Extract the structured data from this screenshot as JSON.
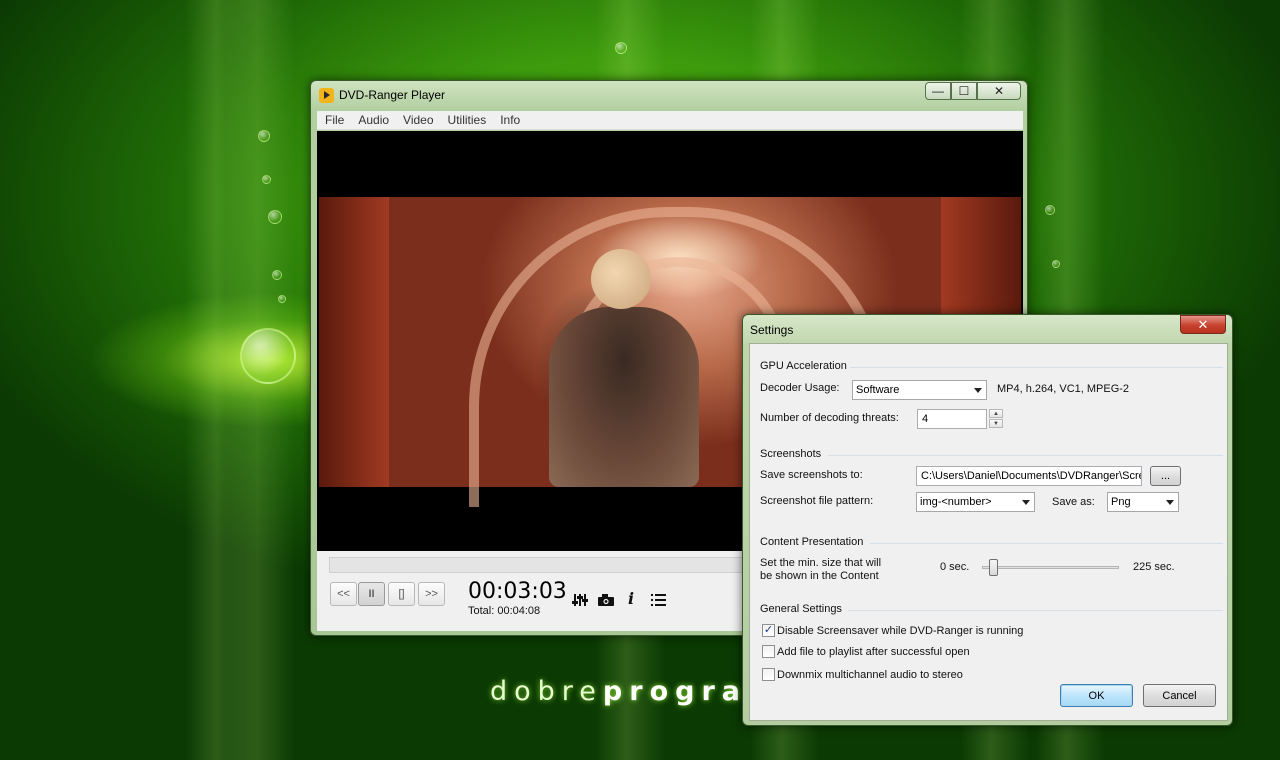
{
  "wallpaper": {
    "brand_light": "dobre",
    "brand_bold": "progra"
  },
  "player": {
    "title": "DVD-Ranger Player",
    "menu": [
      "File",
      "Audio",
      "Video",
      "Utilities",
      "Info"
    ],
    "controls": {
      "prev_label": "<<",
      "pause_label": "II",
      "stop_label": "[]",
      "next_label": ">>",
      "current_time": "00:03:03",
      "total_time": "Total: 00:04:08",
      "equalizer_icon": "equalizer-icon",
      "screenshot_icon": "camera-icon",
      "info_icon": "info-icon",
      "playlist_icon": "playlist-icon"
    },
    "caption": {
      "minimize": "—",
      "maximize": "☐",
      "close": "✕"
    }
  },
  "settings": {
    "title": "Settings",
    "close": "✕",
    "gpu": {
      "heading": "GPU Acceleration",
      "decoder_label": "Decoder Usage:",
      "decoder_value": "Software",
      "formats": "MP4, h.264, VC1, MPEG-2",
      "threads_label": "Number of decoding threats:",
      "threads_value": "4"
    },
    "screenshots": {
      "heading": "Screenshots",
      "save_label": "Save screenshots to:",
      "save_path": "C:\\Users\\Daniel\\Documents\\DVDRanger\\Scree",
      "browse_label": "...",
      "pattern_label": "Screenshot file pattern:",
      "pattern_value": "img-<number>",
      "save_as_label": "Save as:",
      "save_as_value": "Png"
    },
    "content": {
      "heading": "Content Presentation",
      "size_label_1": "Set the min. size that will",
      "size_label_2": "be shown in the Content",
      "min_label": "0 sec.",
      "max_label": "225 sec.",
      "slider_value": 0.08
    },
    "general": {
      "heading": "General Settings",
      "options": [
        {
          "label": "Disable Screensaver while DVD-Ranger is running",
          "checked": true
        },
        {
          "label": "Add file to playlist after successful open",
          "checked": false
        },
        {
          "label": "Downmix multichannel audio to stereo",
          "checked": false
        }
      ]
    },
    "ok_label": "OK",
    "cancel_label": "Cancel"
  }
}
